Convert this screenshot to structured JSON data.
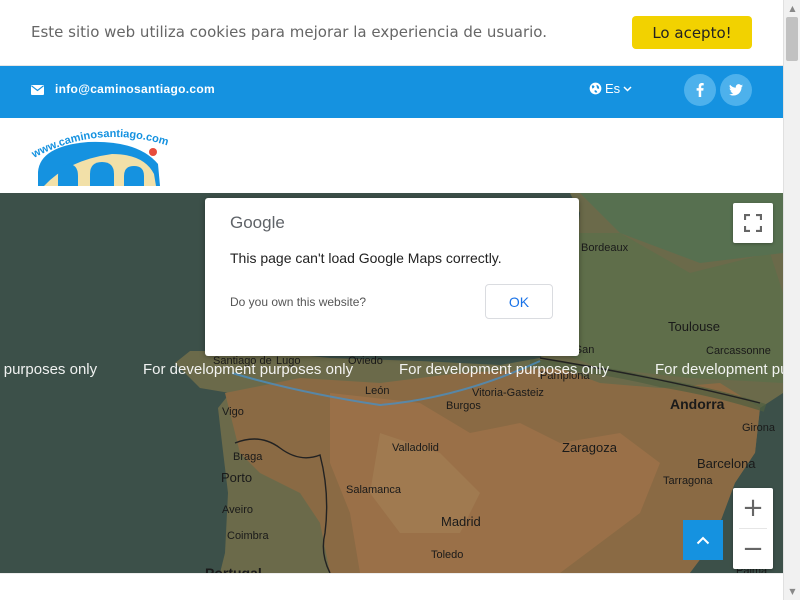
{
  "cookie": {
    "text": "Este sitio web utiliza cookies para mejorar la experiencia de usuario.",
    "accept_label": "Lo acepto!"
  },
  "topbar": {
    "email": "info@caminosantiago.com",
    "language": "Es",
    "social": [
      "facebook-icon",
      "twitter-icon"
    ]
  },
  "logo": {
    "text": "www.caminosantiago.com"
  },
  "map": {
    "watermark": "For development purposes only",
    "places": {
      "bordeaux": "Bordeaux",
      "toulouse": "Toulouse",
      "carcassonne": "Carcassonne",
      "andorra": "Andorra",
      "girona": "Girona",
      "barcelona": "Barcelona",
      "tarragona": "Tarragona",
      "zaragoza": "Zaragoza",
      "valladolid": "Valladolid",
      "salamanca": "Salamanca",
      "madrid": "Madrid",
      "toledo": "Toledo",
      "burgos": "Burgos",
      "vitoria": "Vitoria-Gasteiz",
      "pamplona": "Pamplona",
      "leon": "León",
      "oviedo": "Oviedo",
      "santiago": "Santiago de",
      "lugo": "Lugo",
      "vigo": "Vigo",
      "braga": "Braga",
      "porto": "Porto",
      "aveiro": "Aveiro",
      "coimbra": "Coimbra",
      "sansebastian": "a-San",
      "portugal": "Portugal",
      "palma": "Palma"
    },
    "zoom_in": "+",
    "zoom_out": "−"
  },
  "dialog": {
    "brand": "Google",
    "message": "This page can't load Google Maps correctly.",
    "owner_question": "Do you own this website?",
    "ok_label": "OK"
  },
  "colors": {
    "primary": "#1592e0",
    "accept": "#f2d200",
    "map_land": "#7a6a4a",
    "map_sea": "#3c5049"
  }
}
